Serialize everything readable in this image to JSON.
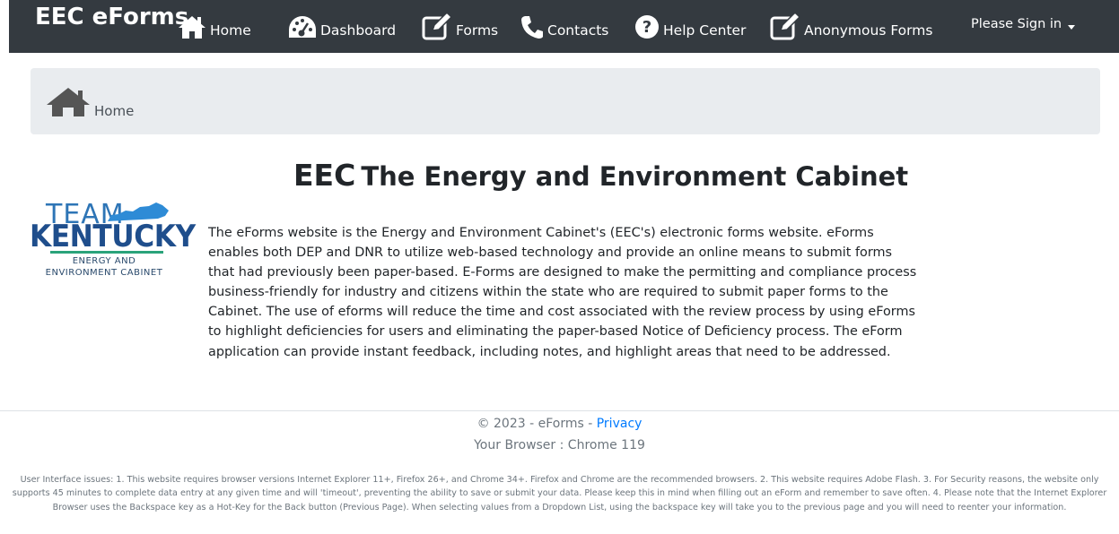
{
  "navbar": {
    "brand": "EEC eForms",
    "items": [
      {
        "label": "Home",
        "icon": "home-icon"
      },
      {
        "label": "Dashboard",
        "icon": "dashboard-icon"
      },
      {
        "label": "Forms",
        "icon": "edit-icon"
      },
      {
        "label": "Contacts",
        "icon": "phone-icon"
      },
      {
        "label": "Help Center",
        "icon": "question-circle-icon"
      },
      {
        "label": "Anonymous Forms",
        "icon": "edit-icon"
      }
    ],
    "signin": "Please Sign in"
  },
  "breadcrumb": {
    "label": "Home",
    "icon": "home-icon"
  },
  "main": {
    "title_abbr": "EEC",
    "title_rest": "The Energy and Environment Cabinet",
    "logo": {
      "team": "TEAM",
      "kentucky": "KENTUCKY",
      "line1": "ENERGY AND",
      "line2": "ENVIRONMENT CABINET"
    },
    "description": "The eForms website is the Energy and Environment Cabinet's (EEC's) electronic forms website. eForms enables both DEP and DNR to utilize web-based technology and provide an online means to submit forms that had previously been paper-based. E-Forms are designed to make the permitting and compliance process business-friendly for industry and citizens within the state who are required to submit paper forms to the Cabinet. The use of eforms will reduce the time and cost associated with the review process by using eForms to highlight deficiencies for users and eliminating the paper-based Notice of Deficiency process. The eForm application can provide instant feedback, including notes, and highlight areas that need to be addressed."
  },
  "footer": {
    "copyright": "© 2023 - eForms - ",
    "privacy": "Privacy",
    "browser": "Your Browser : Chrome 119",
    "issues": "User Interface issues: 1. This website requires browser versions Internet Explorer 11+, Firefox 26+, and Chrome 34+. Firefox and Chrome are the recommended browsers. 2. This website requires Adobe Flash. 3. For Security reasons, the website only supports 45 minutes to complete data entry at any given time and will 'timeout', preventing the ability to save or submit your data. Please keep this in mind when filling out an eForm and remember to save often. 4. Please note that the Internet Explorer Browser uses the Backspace key as a Hot-Key for the Back button (Previous Page). When selecting values from a Dropdown List, using the backspace key will take you to the previous page and you will need to reenter your information."
  },
  "colors": {
    "navbar_bg": "#343a40",
    "breadcrumb_bg": "#e9ecef",
    "link": "#007bff",
    "muted": "#6c757d",
    "logo_blue": "#1f4e8c",
    "logo_green": "#2aa37a"
  }
}
